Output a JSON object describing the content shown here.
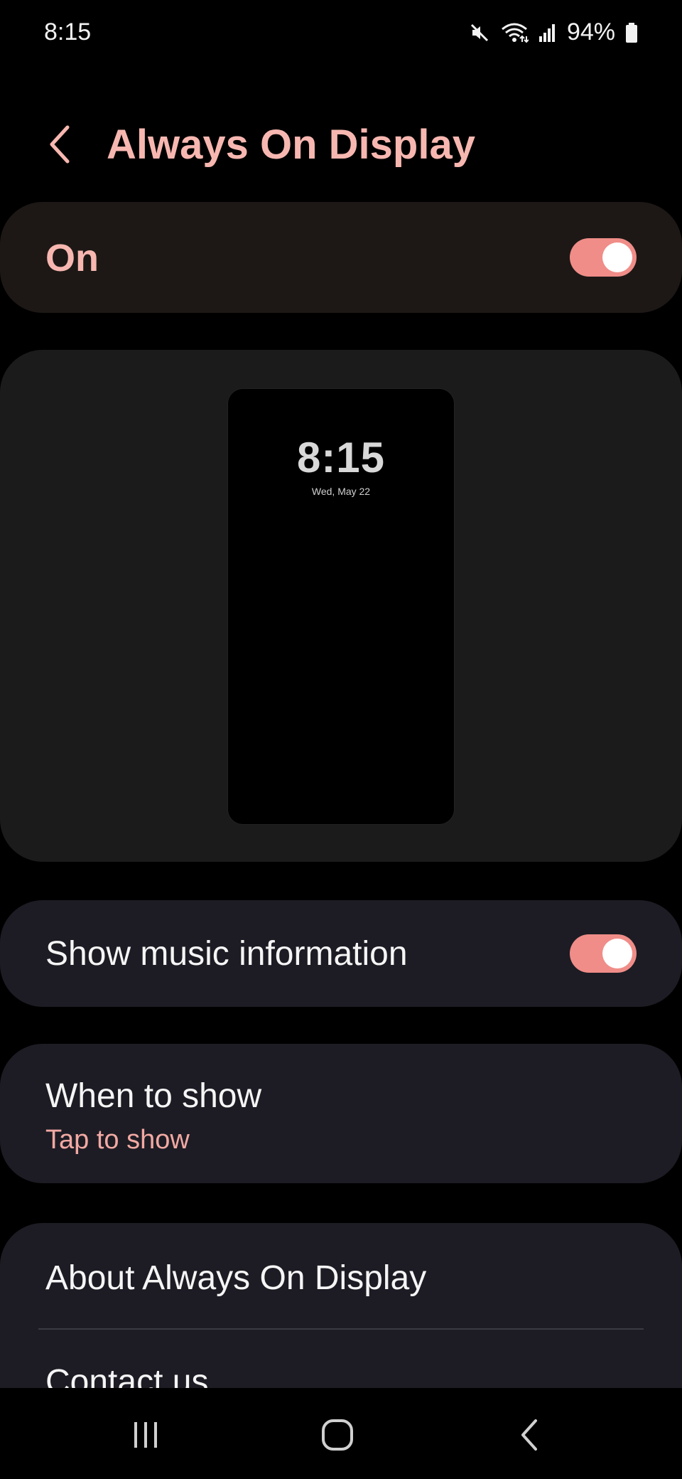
{
  "status_bar": {
    "time": "8:15",
    "battery_percent": "94%",
    "icons": [
      "mute-icon",
      "wifi-icon",
      "signal-icon",
      "battery-icon"
    ]
  },
  "header": {
    "title": "Always On Display",
    "back_icon": "chevron-left-icon"
  },
  "master_switch": {
    "label": "On",
    "state": true
  },
  "preview": {
    "time": "8:15",
    "date": "Wed, May 22"
  },
  "settings": {
    "music": {
      "label": "Show music information",
      "state": true
    },
    "when_to_show": {
      "title": "When to show",
      "value": "Tap to show"
    },
    "about": {
      "label": "About Always On Display"
    },
    "contact": {
      "label": "Contact us"
    }
  },
  "nav_bar": {
    "icons": [
      "recents-icon",
      "home-icon",
      "back-icon"
    ]
  },
  "colors": {
    "accent": "#f7b7b0",
    "toggle_on": "#f08d88",
    "card_bg": "#1d1c24"
  }
}
